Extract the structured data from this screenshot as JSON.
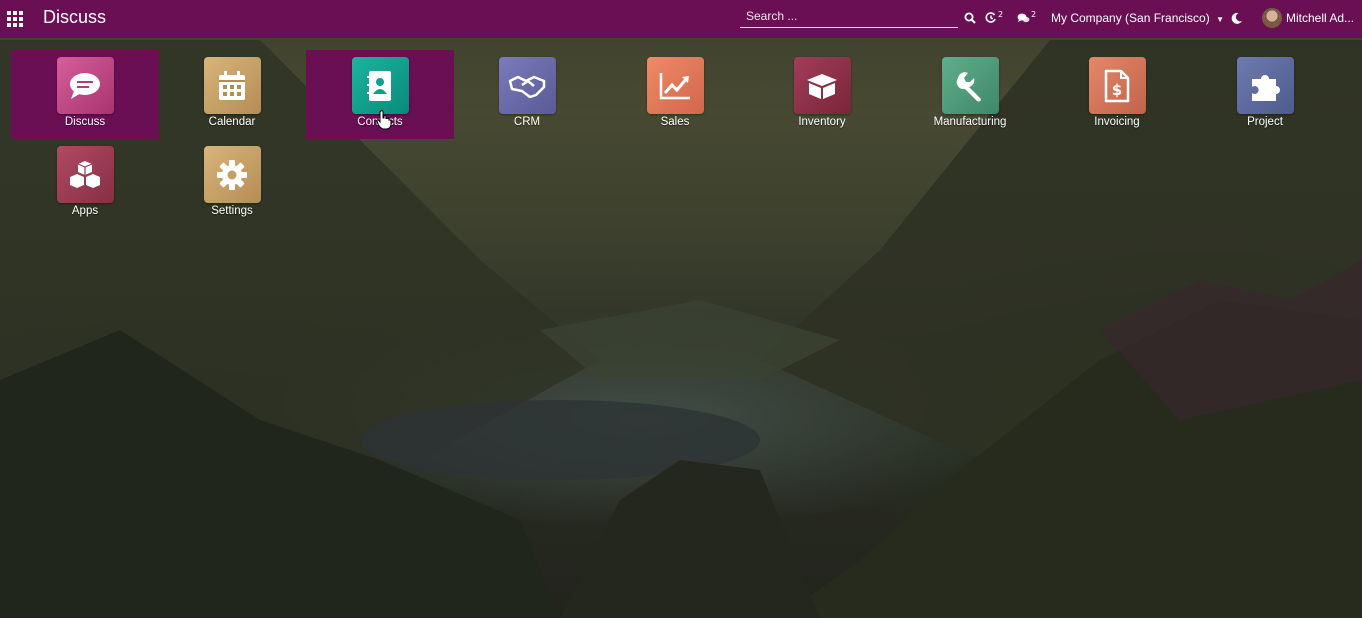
{
  "navbar": {
    "brand": "Discuss",
    "search_placeholder": "Search ...",
    "activity_count": "2",
    "messages_count": "2",
    "company": "My Company (San Francisco)",
    "user": "Mitchell Ad...",
    "background_color": "#6b0f55"
  },
  "apps": [
    {
      "label": "Discuss",
      "icon": "chat-bubble-icon",
      "color": "#c24b8a",
      "active": true
    },
    {
      "label": "Calendar",
      "icon": "calendar-icon",
      "color": "#c8a46a",
      "active": false
    },
    {
      "label": "Contacts",
      "icon": "address-book-icon",
      "color": "#0e9f8f",
      "active": true
    },
    {
      "label": "CRM",
      "icon": "handshake-icon",
      "color": "#6e6eae",
      "active": false
    },
    {
      "label": "Sales",
      "icon": "trend-chart-icon",
      "color": "#e0785a",
      "active": false
    },
    {
      "label": "Inventory",
      "icon": "box-icon",
      "color": "#8c2f47",
      "active": false
    },
    {
      "label": "Manufacturing",
      "icon": "wrench-icon",
      "color": "#4f9a7a",
      "active": false
    },
    {
      "label": "Invoicing",
      "icon": "invoice-dollar-icon",
      "color": "#d2745a",
      "active": false
    },
    {
      "label": "Project",
      "icon": "puzzle-icon",
      "color": "#5d6b9e",
      "active": false
    },
    {
      "label": "Apps",
      "icon": "cubes-icon",
      "color": "#9a3a52",
      "active": false
    },
    {
      "label": "Settings",
      "icon": "gear-icon",
      "color": "#c8a46a",
      "active": false
    }
  ]
}
